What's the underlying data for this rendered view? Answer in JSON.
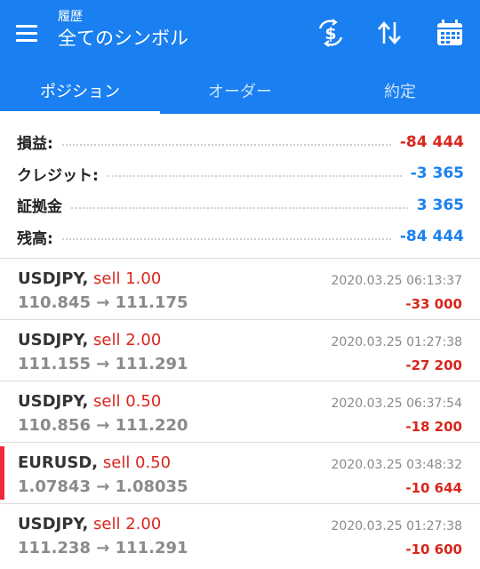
{
  "header": {
    "subtitle": "履歴",
    "title": "全てのシンボル",
    "icons": [
      "menu-icon",
      "currency-exchange-icon",
      "sort-icon",
      "calendar-icon"
    ]
  },
  "tabs": [
    {
      "label": "ポジション",
      "active": true
    },
    {
      "label": "オーダー",
      "active": false
    },
    {
      "label": "約定",
      "active": false
    }
  ],
  "summary": [
    {
      "label": "損益:",
      "value": "-84 444",
      "color": "#d9261c"
    },
    {
      "label": "クレジット:",
      "value": "-3 365",
      "color": "#1a7ff0"
    },
    {
      "label": "証拠金",
      "value": "3 365",
      "color": "#1a7ff0"
    },
    {
      "label": "残高:",
      "value": "-84 444",
      "color": "#1a7ff0"
    }
  ],
  "positions": [
    {
      "symbol": "USDJPY,",
      "action": "sell 1.00",
      "prices": "110.845 → 111.175",
      "time": "2020.03.25 06:13:37",
      "profit": "-33 000",
      "marked": false
    },
    {
      "symbol": "USDJPY,",
      "action": "sell 2.00",
      "prices": "111.155 → 111.291",
      "time": "2020.03.25 01:27:38",
      "profit": "-27 200",
      "marked": false
    },
    {
      "symbol": "USDJPY,",
      "action": "sell 0.50",
      "prices": "110.856 → 111.220",
      "time": "2020.03.25 06:37:54",
      "profit": "-18 200",
      "marked": false
    },
    {
      "symbol": "EURUSD,",
      "action": "sell 0.50",
      "prices": "1.07843 → 1.08035",
      "time": "2020.03.25 03:48:32",
      "profit": "-10 644",
      "marked": true
    },
    {
      "symbol": "USDJPY,",
      "action": "sell 2.00",
      "prices": "111.238 → 111.291",
      "time": "2020.03.25 01:27:38",
      "profit": "-10 600",
      "marked": false
    }
  ],
  "colors": {
    "accent": "#1a7ff0",
    "loss": "#d9261c",
    "marker": "#f0283c"
  }
}
